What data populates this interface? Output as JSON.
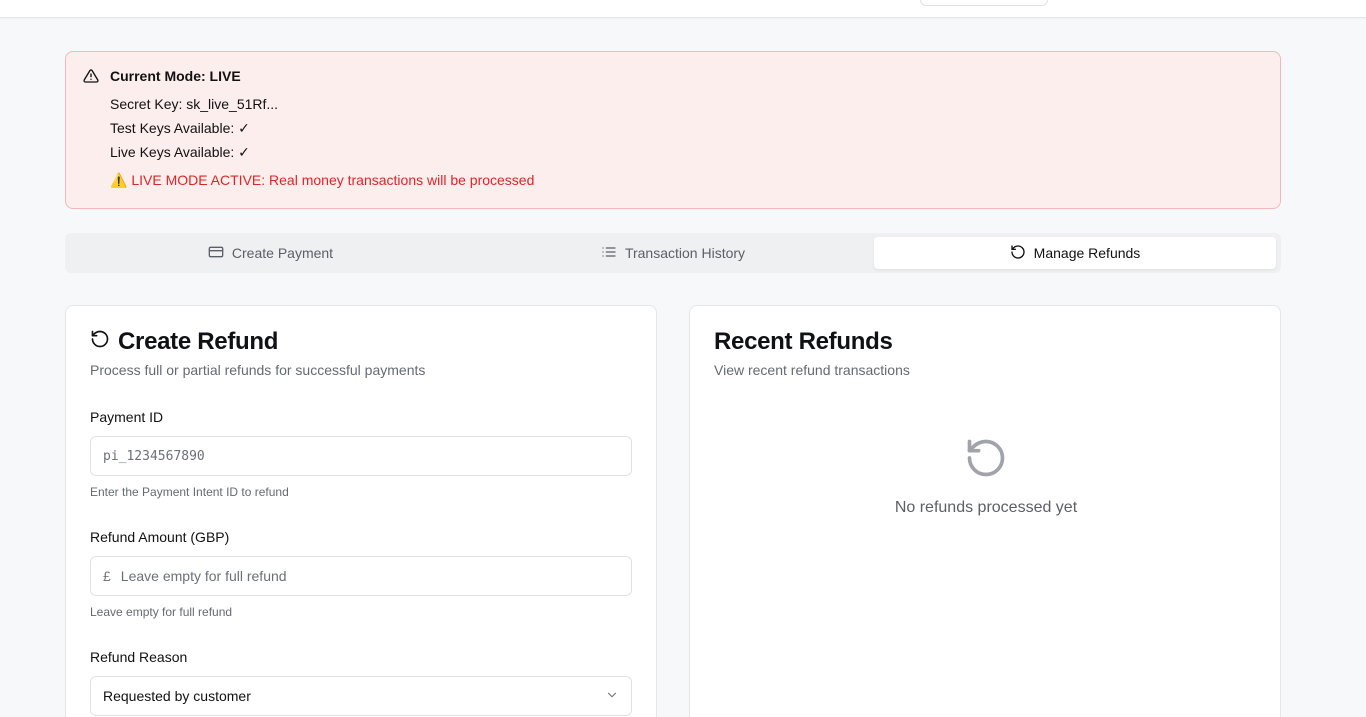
{
  "alert": {
    "title": "Current Mode: LIVE",
    "secret_key": "Secret Key: sk_live_51Rf...",
    "test_keys": "Test Keys Available: ✓",
    "live_keys": "Live Keys Available: ✓",
    "warning": "⚠️ LIVE MODE ACTIVE: Real money transactions will be processed"
  },
  "tabs": [
    {
      "label": "Create Payment",
      "icon": "card-icon"
    },
    {
      "label": "Transaction History",
      "icon": "list-icon"
    },
    {
      "label": "Manage Refunds",
      "icon": "refresh-icon",
      "active": true
    }
  ],
  "create_refund": {
    "title": "Create Refund",
    "subtitle": "Process full or partial refunds for successful payments",
    "payment_id": {
      "label": "Payment ID",
      "placeholder": "pi_1234567890",
      "hint": "Enter the Payment Intent ID to refund"
    },
    "amount": {
      "label": "Refund Amount (GBP)",
      "prefix": "£",
      "placeholder": "Leave empty for full refund",
      "hint": "Leave empty for full refund"
    },
    "reason": {
      "label": "Refund Reason",
      "selected": "Requested by customer"
    }
  },
  "recent_refunds": {
    "title": "Recent Refunds",
    "subtitle": "View recent refund transactions",
    "empty_message": "No refunds processed yet"
  },
  "colors": {
    "alert_bg": "#fdeeee",
    "alert_border": "#f3b8bb",
    "warning_text": "#dc2626",
    "page_bg": "#f7f8fa"
  }
}
